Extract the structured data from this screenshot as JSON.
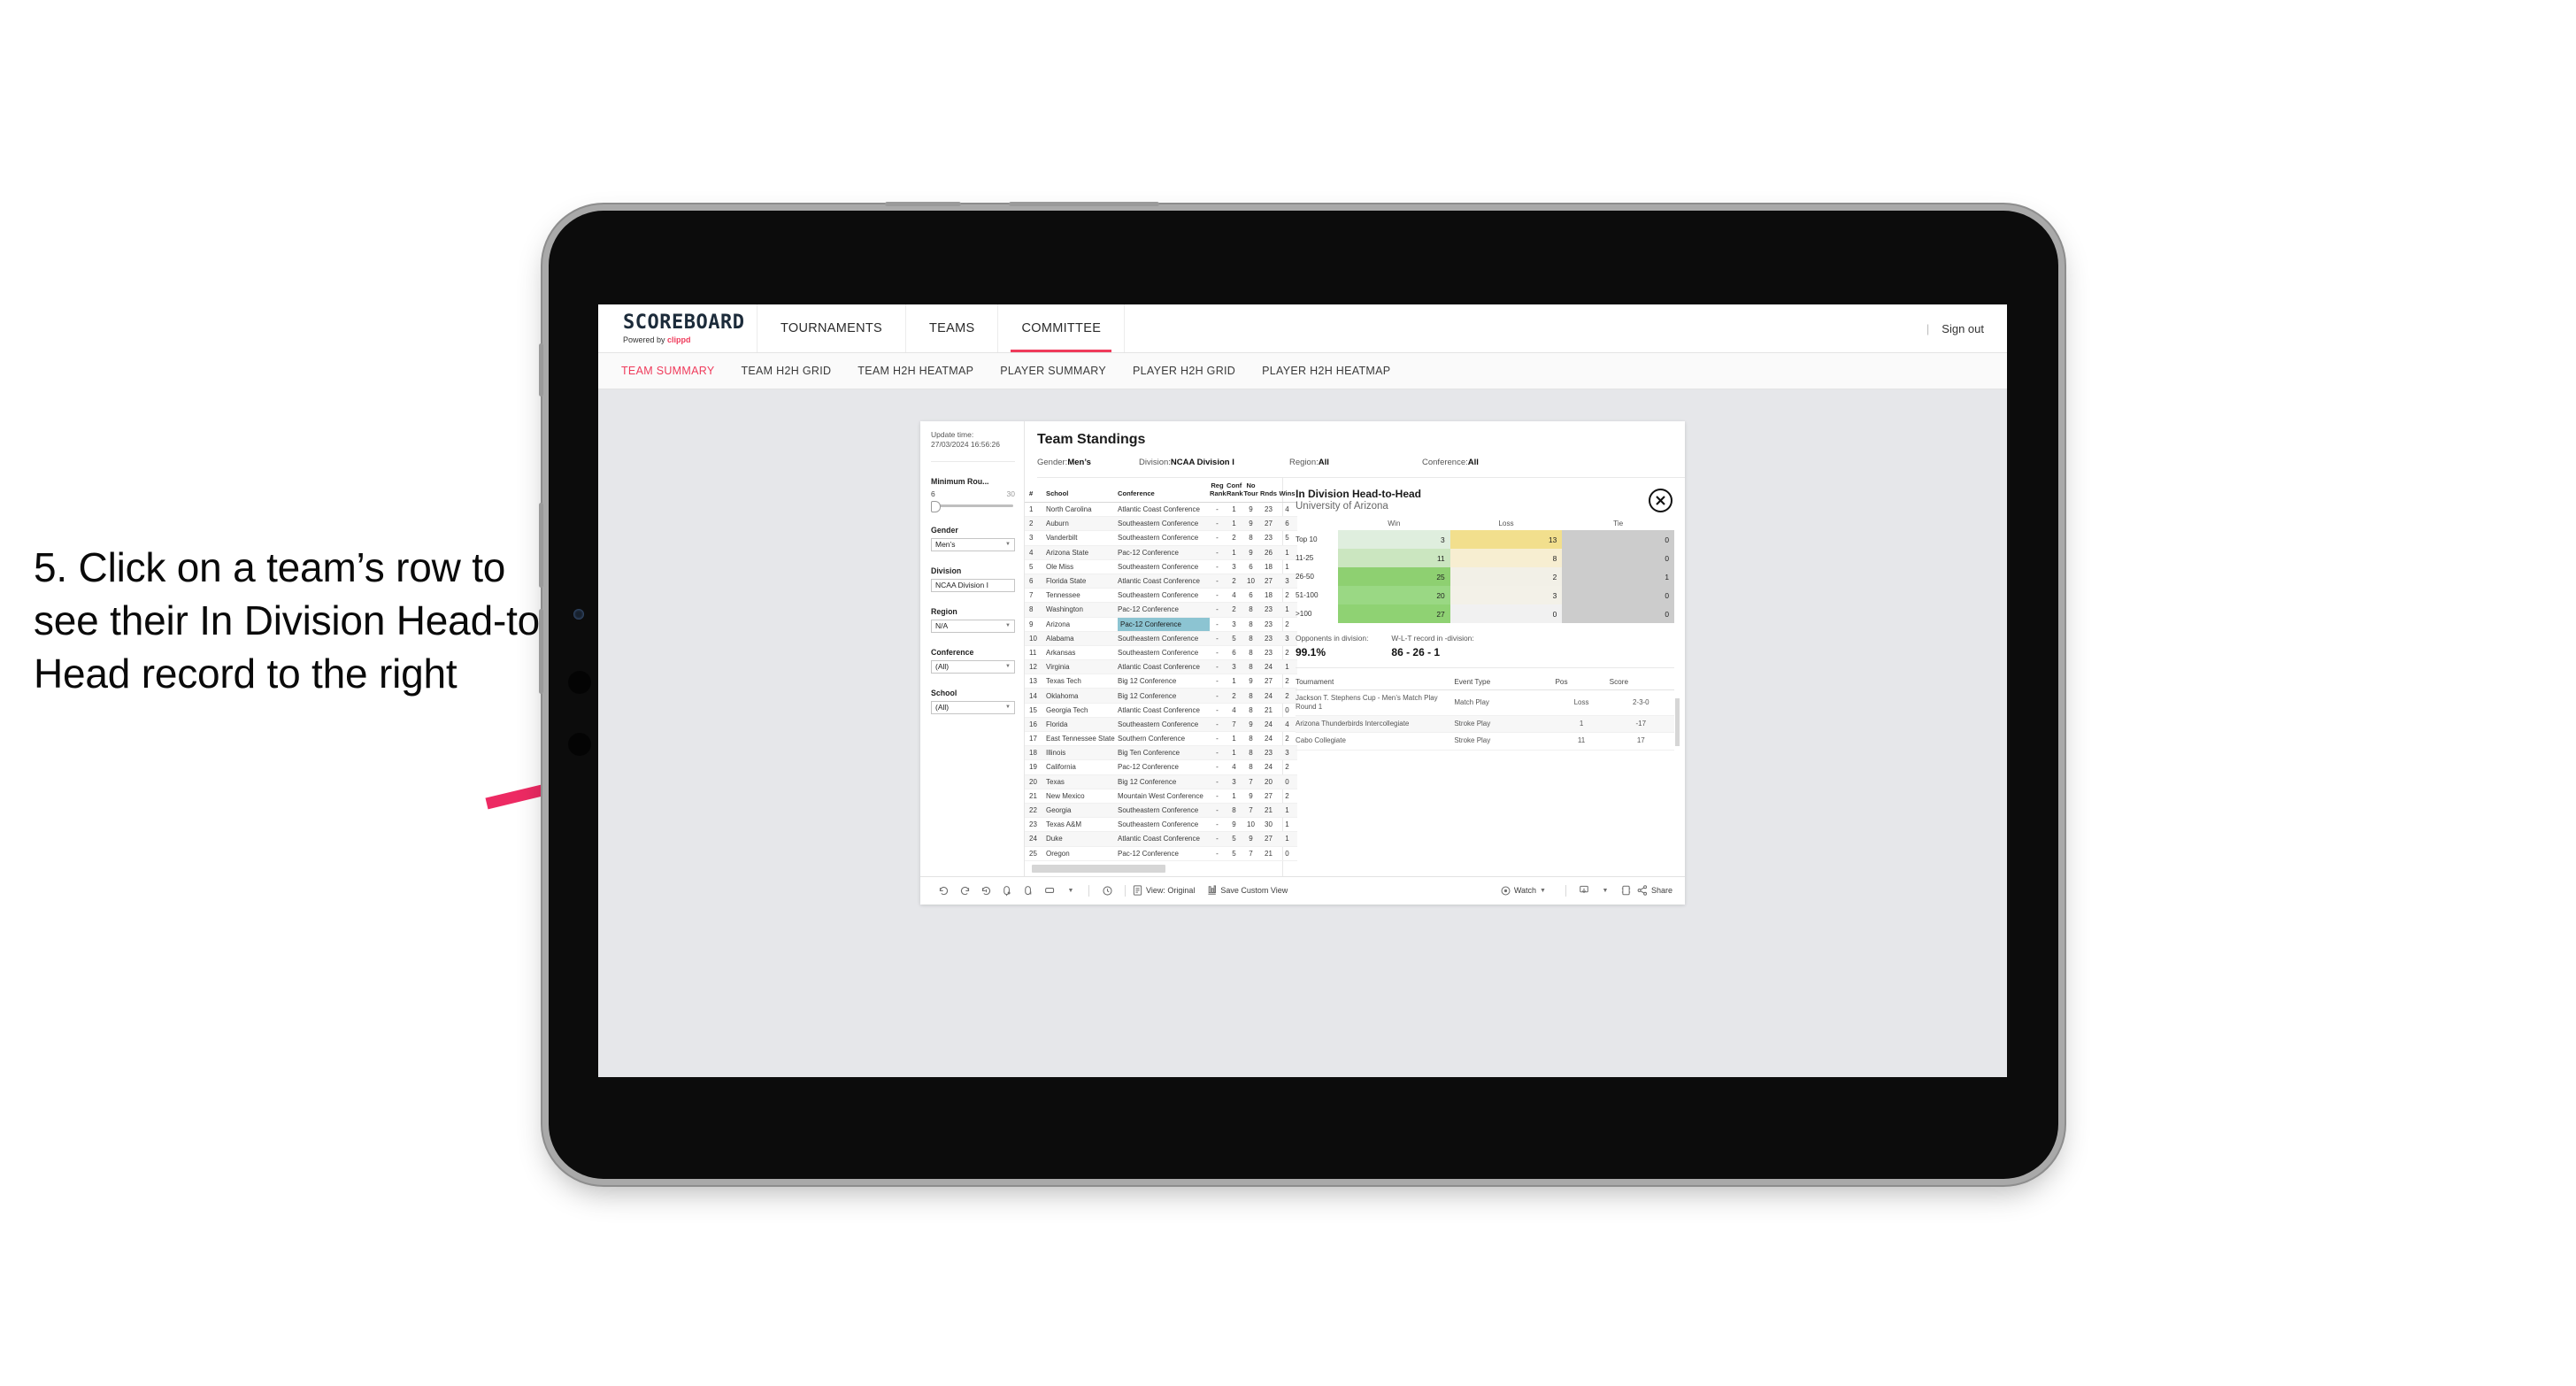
{
  "annotation": {
    "text": "5. Click on a team’s row to see their In Division Head-to-Head record to the right",
    "arrow_color": "#ED2A63"
  },
  "app": {
    "logo": {
      "main": "SCOREBOARD",
      "sub_prefix": "Powered by ",
      "sub_brand": "clippd"
    },
    "top_nav": [
      {
        "label": "TOURNAMENTS",
        "active": false
      },
      {
        "label": "TEAMS",
        "active": false
      },
      {
        "label": "COMMITTEE",
        "active": true
      }
    ],
    "top_right": {
      "divider": "|",
      "sign_out": "Sign out"
    },
    "sub_nav": [
      {
        "label": "TEAM SUMMARY",
        "active": true
      },
      {
        "label": "TEAM H2H GRID",
        "active": false
      },
      {
        "label": "TEAM H2H HEATMAP",
        "active": false
      },
      {
        "label": "PLAYER SUMMARY",
        "active": false
      },
      {
        "label": "PLAYER H2H GRID",
        "active": false
      },
      {
        "label": "PLAYER H2H HEATMAP",
        "active": false
      }
    ]
  },
  "filters": {
    "update_time_label": "Update time:",
    "update_time_value": "27/03/2024 16:56:26",
    "min_rounds": {
      "title": "Minimum Rou...",
      "low": "6",
      "high": "30"
    },
    "selects": [
      {
        "title": "Gender",
        "value": "Men’s"
      },
      {
        "title": "Division",
        "value": "NCAA Division I"
      },
      {
        "title": "Region",
        "value": "N/A"
      },
      {
        "title": "Conference",
        "value": "(All)"
      },
      {
        "title": "School",
        "value": "(All)"
      }
    ]
  },
  "report": {
    "title": "Team Standings",
    "meta": [
      {
        "key": "Gender: ",
        "value": "Men’s"
      },
      {
        "key": "Division: ",
        "value": "NCAA Division I"
      },
      {
        "key": "Region: ",
        "value": "All"
      },
      {
        "key": "Conference: ",
        "value": "All"
      }
    ]
  },
  "standings": {
    "columns": [
      "#",
      "School",
      "Conference",
      "Reg Rank",
      "Conf Rank",
      "No Tour",
      "Rnds",
      "Wins"
    ],
    "highlight_row_index": 8,
    "rows": [
      [
        "1",
        "North Carolina",
        "Atlantic Coast Conference",
        "-",
        "1",
        "9",
        "23",
        "4"
      ],
      [
        "2",
        "Auburn",
        "Southeastern Conference",
        "-",
        "1",
        "9",
        "27",
        "6"
      ],
      [
        "3",
        "Vanderbilt",
        "Southeastern Conference",
        "-",
        "2",
        "8",
        "23",
        "5"
      ],
      [
        "4",
        "Arizona State",
        "Pac-12 Conference",
        "-",
        "1",
        "9",
        "26",
        "1"
      ],
      [
        "5",
        "Ole Miss",
        "Southeastern Conference",
        "-",
        "3",
        "6",
        "18",
        "1"
      ],
      [
        "6",
        "Florida State",
        "Atlantic Coast Conference",
        "-",
        "2",
        "10",
        "27",
        "3"
      ],
      [
        "7",
        "Tennessee",
        "Southeastern Conference",
        "-",
        "4",
        "6",
        "18",
        "2"
      ],
      [
        "8",
        "Washington",
        "Pac-12 Conference",
        "-",
        "2",
        "8",
        "23",
        "1"
      ],
      [
        "9",
        "Arizona",
        "Pac-12 Conference",
        "-",
        "3",
        "8",
        "23",
        "2"
      ],
      [
        "10",
        "Alabama",
        "Southeastern Conference",
        "-",
        "5",
        "8",
        "23",
        "3"
      ],
      [
        "11",
        "Arkansas",
        "Southeastern Conference",
        "-",
        "6",
        "8",
        "23",
        "2"
      ],
      [
        "12",
        "Virginia",
        "Atlantic Coast Conference",
        "-",
        "3",
        "8",
        "24",
        "1"
      ],
      [
        "13",
        "Texas Tech",
        "Big 12 Conference",
        "-",
        "1",
        "9",
        "27",
        "2"
      ],
      [
        "14",
        "Oklahoma",
        "Big 12 Conference",
        "-",
        "2",
        "8",
        "24",
        "2"
      ],
      [
        "15",
        "Georgia Tech",
        "Atlantic Coast Conference",
        "-",
        "4",
        "8",
        "21",
        "0"
      ],
      [
        "16",
        "Florida",
        "Southeastern Conference",
        "-",
        "7",
        "9",
        "24",
        "4"
      ],
      [
        "17",
        "East Tennessee State",
        "Southern Conference",
        "-",
        "1",
        "8",
        "24",
        "2"
      ],
      [
        "18",
        "Illinois",
        "Big Ten Conference",
        "-",
        "1",
        "8",
        "23",
        "3"
      ],
      [
        "19",
        "California",
        "Pac-12 Conference",
        "-",
        "4",
        "8",
        "24",
        "2"
      ],
      [
        "20",
        "Texas",
        "Big 12 Conference",
        "-",
        "3",
        "7",
        "20",
        "0"
      ],
      [
        "21",
        "New Mexico",
        "Mountain West Conference",
        "-",
        "1",
        "9",
        "27",
        "2"
      ],
      [
        "22",
        "Georgia",
        "Southeastern Conference",
        "-",
        "8",
        "7",
        "21",
        "1"
      ],
      [
        "23",
        "Texas A&M",
        "Southeastern Conference",
        "-",
        "9",
        "10",
        "30",
        "1"
      ],
      [
        "24",
        "Duke",
        "Atlantic Coast Conference",
        "-",
        "5",
        "9",
        "27",
        "1"
      ],
      [
        "25",
        "Oregon",
        "Pac-12 Conference",
        "-",
        "5",
        "7",
        "21",
        "0"
      ]
    ]
  },
  "h2h": {
    "title": "In Division Head-to-Head",
    "subtitle": "University of Arizona",
    "close_icon": "close-circle-icon",
    "heatmap": {
      "columns": [
        "Win",
        "Loss",
        "Tie"
      ],
      "rows": [
        {
          "label": "Top 10",
          "win": "3",
          "loss": "13",
          "tie": "0",
          "win_color": "#dfeede",
          "loss_color": "#f2df8d",
          "tie_color": "#cccccc"
        },
        {
          "label": "11-25",
          "win": "11",
          "loss": "8",
          "tie": "0",
          "win_color": "#cbe6c0",
          "loss_color": "#f7eed1",
          "tie_color": "#cccccc"
        },
        {
          "label": "26-50",
          "win": "25",
          "loss": "2",
          "tie": "1",
          "win_color": "#8ed071",
          "loss_color": "#f2f0e7",
          "tie_color": "#cccccc"
        },
        {
          "label": "51-100",
          "win": "20",
          "loss": "3",
          "tie": "0",
          "win_color": "#9ad884",
          "loss_color": "#f3f1e8",
          "tie_color": "#cccccc"
        },
        {
          "label": ">100",
          "win": "27",
          "loss": "0",
          "tie": "0",
          "win_color": "#8fd273",
          "loss_color": "#f1f1f1",
          "tie_color": "#cccccc"
        }
      ]
    },
    "stats": [
      {
        "key": "Opponents in division:",
        "value": "99.1%"
      },
      {
        "key": "W-L-T record in -division:",
        "value": "86 - 26 - 1"
      }
    ],
    "tournaments": {
      "columns": [
        "Tournament",
        "Event Type",
        "Pos",
        "Score"
      ],
      "rows": [
        [
          "Jackson T. Stephens Cup - Men’s Match Play Round 1",
          "Match Play",
          "Loss",
          "2-3-0"
        ],
        [
          "Arizona Thunderbirds Intercollegiate",
          "Stroke Play",
          "1",
          "-17"
        ],
        [
          "Cabo Collegiate",
          "Stroke Play",
          "11",
          "17"
        ]
      ]
    }
  },
  "toolbar": {
    "icons": [
      "undo-icon",
      "redo-icon",
      "revert-icon",
      "refresh-icon",
      "pause-icon",
      "rectangle-select-icon",
      "chevron-down-icon",
      "clock-history-icon"
    ],
    "view_label": "View: Original",
    "save_label": "Save Custom View",
    "watch_label": "Watch",
    "share_label": "Share"
  }
}
